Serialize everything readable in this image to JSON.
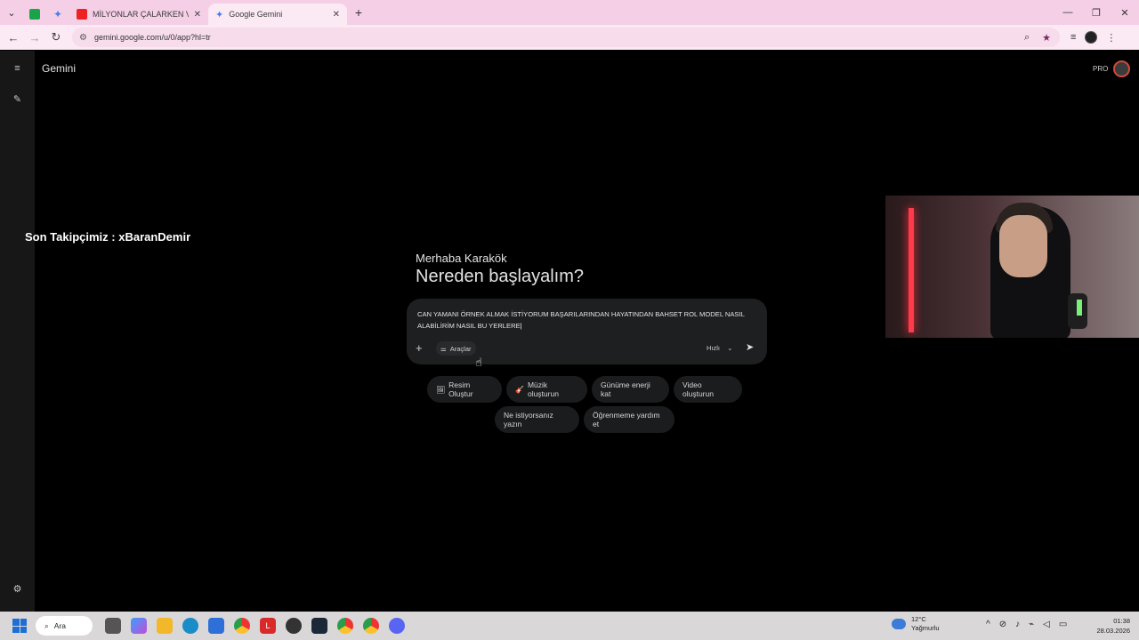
{
  "browser": {
    "tabs": [
      {
        "label": "",
        "icon": "k-icon"
      },
      {
        "label": "",
        "icon": "gemini-star-icon"
      },
      {
        "label": "MİLYONLAR ÇALARKEN VLOG",
        "icon": "youtube-icon"
      },
      {
        "label": "Google Gemini",
        "icon": "gemini-star-icon",
        "active": true
      }
    ],
    "new_tab": "+",
    "url": "gemini.google.com/u/0/app?hl=tr",
    "window_controls": {
      "minimize": "—",
      "maximize": "❐",
      "close": "✕"
    }
  },
  "app": {
    "title": "Gemini",
    "pro_badge": "PRO",
    "greeting": "Merhaba Karakök",
    "headline": "Nereden başlayalım?",
    "prompt": "CAN YAMANI ÖRNEK ALMAK İSTİYORUM BAŞARILARINDAN HAYATINDAN BAHSET ROL MODEL NASIL ALABİLİRİM NASIL BU YERLERE",
    "tools_label": "Araçlar",
    "speed_label": "Hızlı",
    "chips": [
      {
        "label": "Resim Oluştur",
        "icon": "🖼"
      },
      {
        "label": "Müzik oluşturun",
        "icon": "🎸"
      },
      {
        "label": "Günüme enerji kat",
        "icon": ""
      },
      {
        "label": "Video oluşturun",
        "icon": ""
      },
      {
        "label": "Ne istiyorsanız yazın",
        "icon": ""
      },
      {
        "label": "Öğrenmeme yardım et",
        "icon": ""
      }
    ]
  },
  "overlay": {
    "follower_text": "Son Takipçimiz : xBaranDemir"
  },
  "taskbar": {
    "search_label": "Ara",
    "weather_temp": "12°C",
    "weather_desc": "Yağmurlu",
    "time": "01:38",
    "date": "28.03.2026"
  },
  "colors": {
    "tabbar_bg": "#f4cfe6",
    "app_bg": "#000000",
    "composer_bg": "#1e1f20",
    "chip_bg": "#1b1c1d",
    "taskbar_bg": "#d9d7d8",
    "webcam_light": "#ff3a4a"
  }
}
